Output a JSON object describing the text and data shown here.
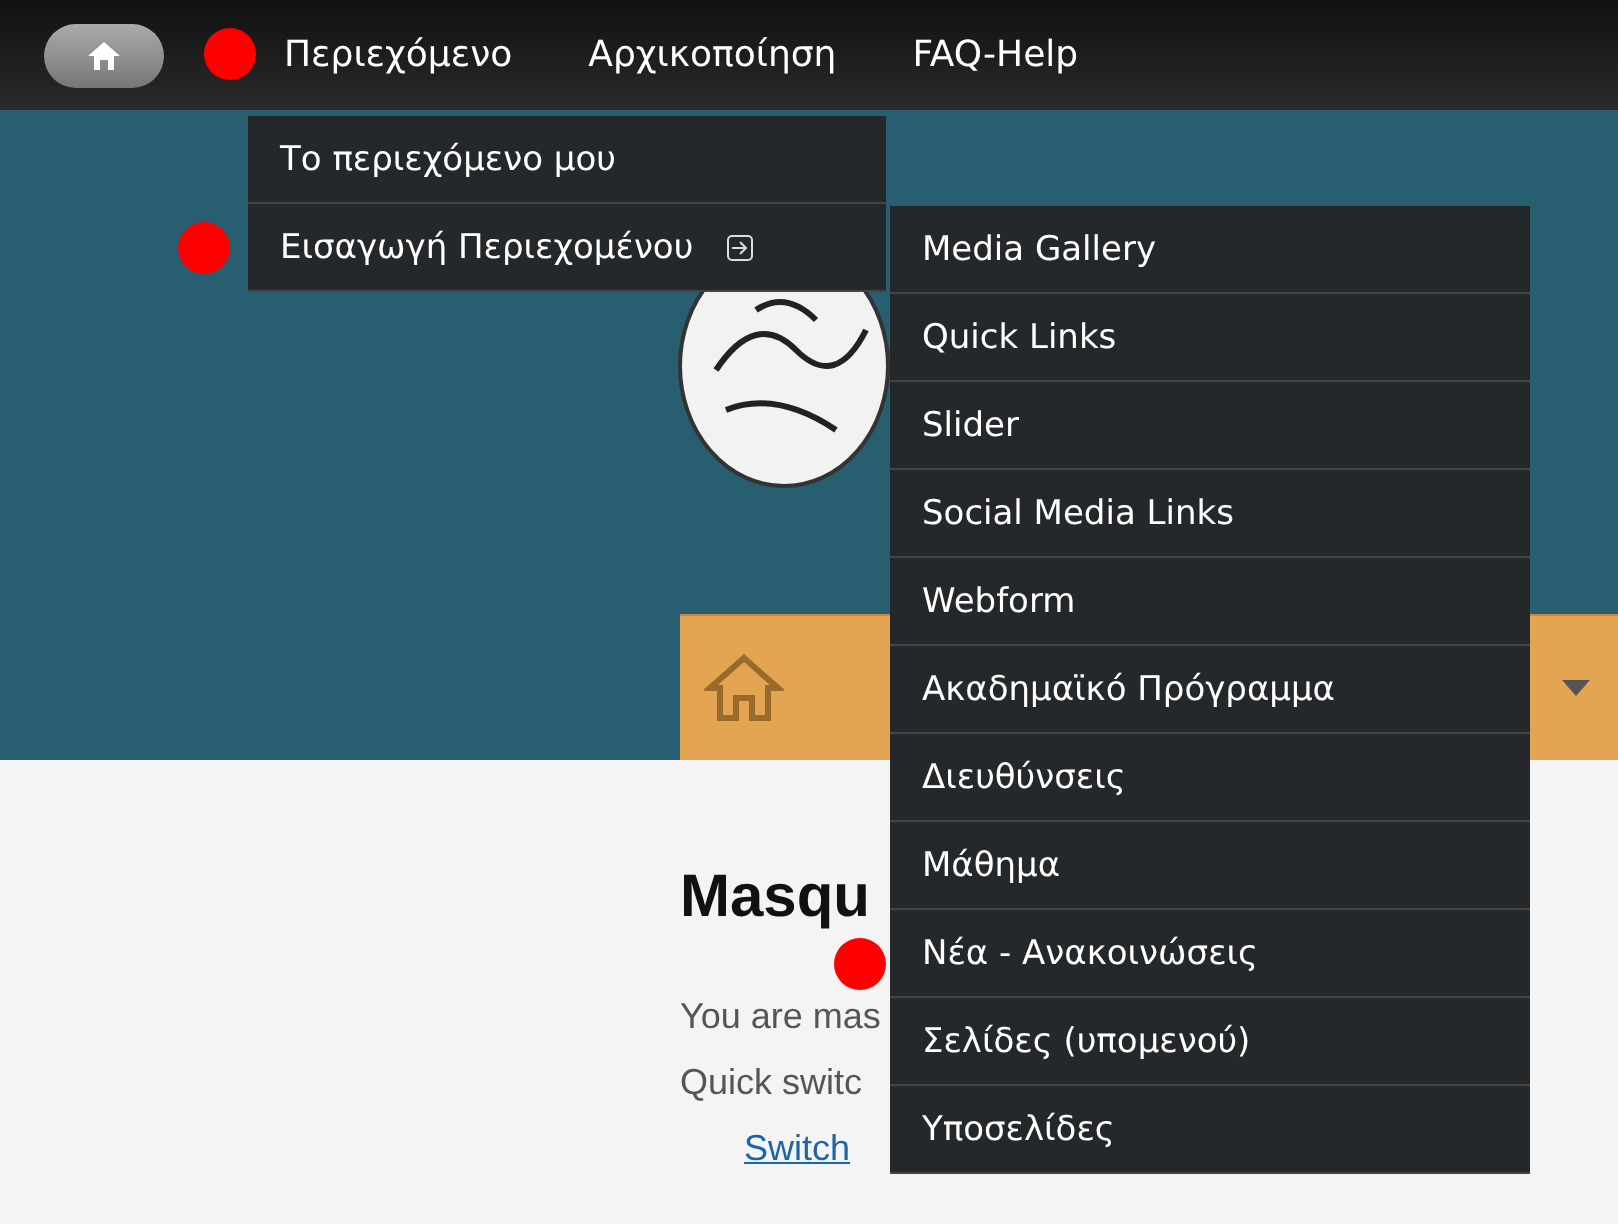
{
  "top_bar": {
    "items": [
      {
        "label": "Περιεχόμενο"
      },
      {
        "label": "Αρχικοποίηση"
      },
      {
        "label": "FAQ-Help"
      }
    ]
  },
  "content_menu": {
    "items": [
      {
        "label": "Το περιεχόμενο μου",
        "has_submenu": false
      },
      {
        "label": "Εισαγωγή Περιεχομένου",
        "has_submenu": true
      }
    ]
  },
  "submenu": {
    "items": [
      "Media Gallery",
      "Quick Links",
      "Slider",
      "Social Media Links",
      "Webform",
      "Ακαδημαϊκό Πρόγραμμα",
      "Διευθύνσεις",
      "Μάθημα",
      "Νέα - Ανακοινώσεις",
      "Σελίδες (υπομενού)",
      "Υποσελίδες"
    ]
  },
  "masquerade": {
    "heading": "Masqu",
    "text": "You are mas",
    "quick_label": "Quick switc",
    "switch_link": "Switch"
  }
}
